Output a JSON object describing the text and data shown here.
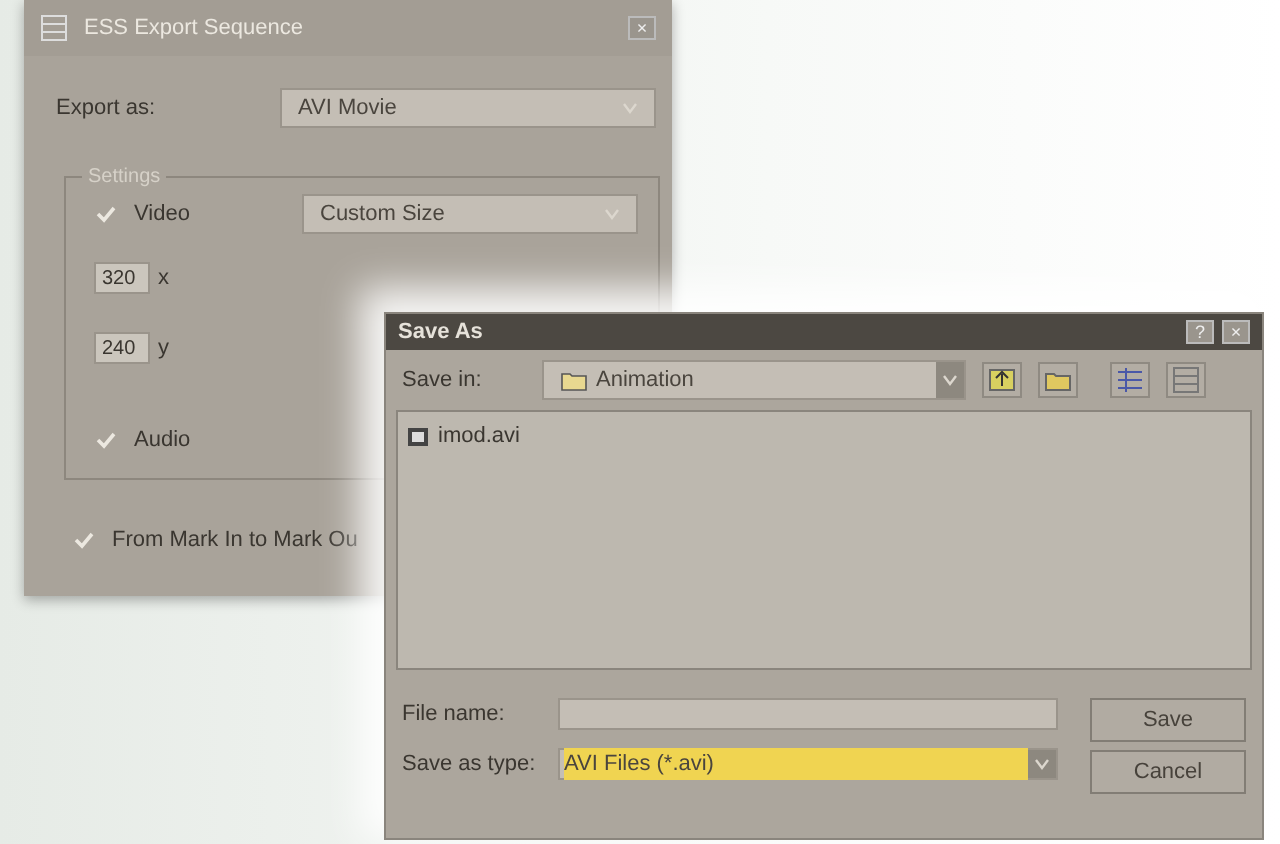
{
  "export_dialog": {
    "title": "ESS Export Sequence",
    "close": "×",
    "export_as": {
      "label": "Export as:",
      "value": "AVI Movie"
    },
    "settings": {
      "legend": "Settings",
      "video": {
        "label": "Video",
        "checked": true,
        "preset": "Custom Size"
      },
      "width": {
        "value": "320",
        "unit": "x"
      },
      "height": {
        "value": "240",
        "unit": "y"
      },
      "audio": {
        "label": "Audio",
        "checked": true
      }
    },
    "range": {
      "label": "From Mark In to Mark Ou",
      "checked": true
    }
  },
  "save_dialog": {
    "title": "Save As",
    "help": "?",
    "close": "×",
    "save_in": {
      "label": "Save in:",
      "value": "Animation"
    },
    "files": [
      {
        "name": "imod.avi"
      }
    ],
    "file_name": {
      "label": "File name:"
    },
    "save_as_type": {
      "label": "Save as type:",
      "value": "AVI Files (*.avi)",
      "highlighted": true
    },
    "buttons": [
      "Save",
      "Cancel"
    ]
  }
}
